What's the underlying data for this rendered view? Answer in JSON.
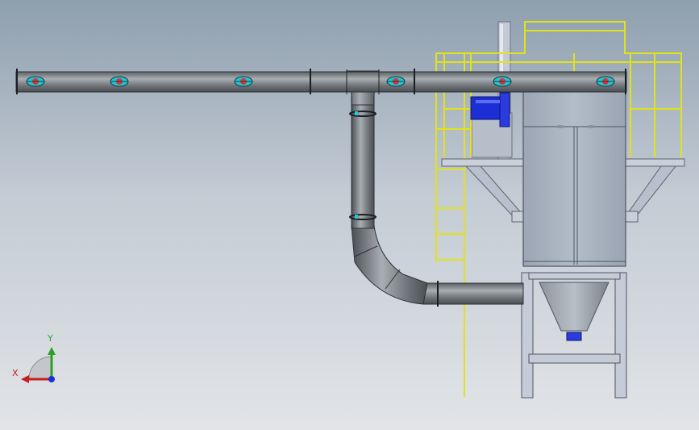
{
  "app": {
    "view": "front",
    "colors": {
      "background_top": "#8e9fae",
      "background_bottom": "#e2e4e7",
      "duct": "#6e7378",
      "duct_highlight": "#a9aeb3",
      "collector_body": "#a9b4c2",
      "railing": "#e2e21a",
      "fan_motor": "#1c2fd6",
      "steel_frame": "#b7c0cc",
      "inspection_port": "#25c4d6"
    }
  },
  "model": {
    "components": [
      "main-duct",
      "tee-fitting",
      "vertical-drop",
      "elbow",
      "inlet-duct",
      "dust-collector",
      "hopper",
      "support-frame",
      "handrail",
      "ladder",
      "fan-motor",
      "stack"
    ],
    "inspection_port_count": 6
  },
  "triad": {
    "x_label": "X",
    "y_label": "Y",
    "x_color": "#c81e1e",
    "y_color": "#2aa02a",
    "z_color": "#1c2fd6"
  }
}
